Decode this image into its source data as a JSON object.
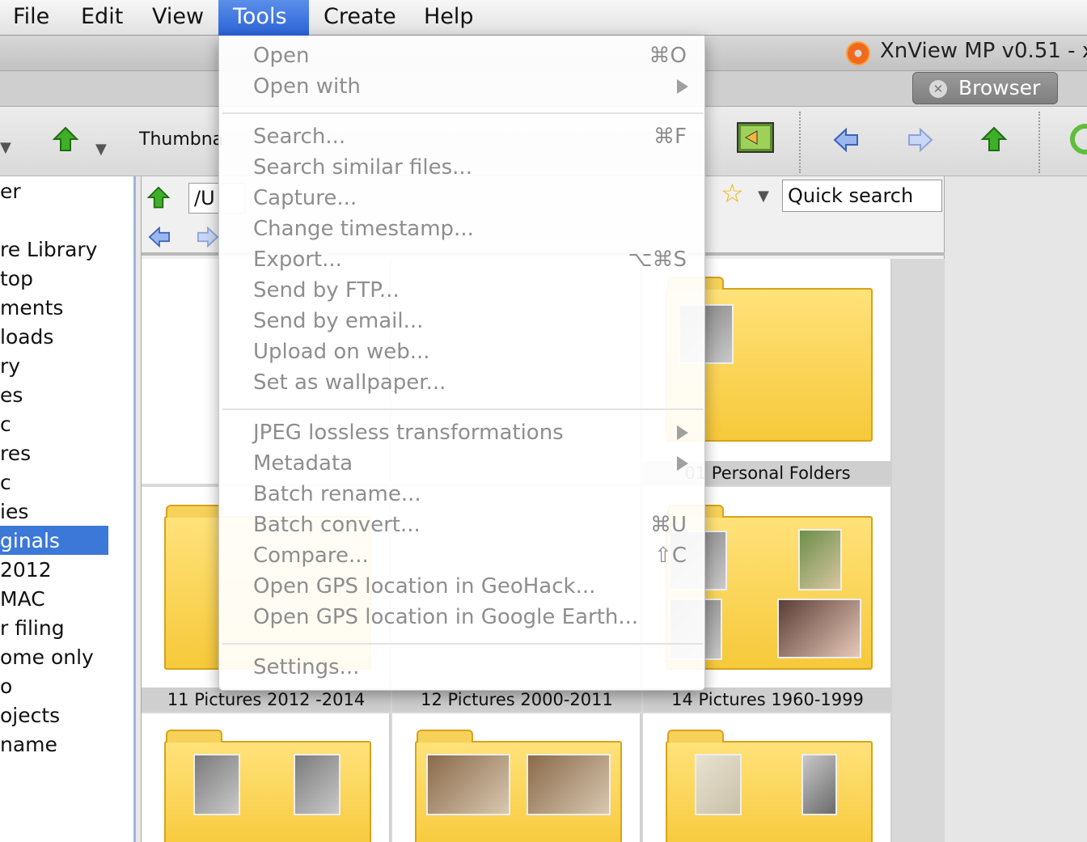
{
  "menubar": {
    "items": [
      "File",
      "Edit",
      "View",
      "Tools",
      "Create",
      "Help"
    ],
    "active": "Tools"
  },
  "window": {
    "title": "XnView MP v0.51 - x",
    "tab_label": "Browser"
  },
  "toolbar": {
    "thumbnail_label": "Thumbna"
  },
  "tree": {
    "items": [
      "er",
      "re Library",
      "top",
      "ments",
      "loads",
      "ry",
      "es",
      "c",
      "res",
      "c",
      "ies",
      "ginals",
      "2012",
      "MAC",
      "r filing",
      "ome only",
      "o",
      "ojects",
      "name"
    ],
    "selected_index": 11
  },
  "browser": {
    "path": "/U",
    "quick_search_placeholder": "Quick search",
    "captions": [
      "01 Personal Folders",
      "11 Pictures 2012 -2014",
      "12 Pictures 2000-2011",
      "14 Pictures 1960-1999"
    ]
  },
  "tools_menu": {
    "items": [
      {
        "label": "Open",
        "shortcut": "⌘O"
      },
      {
        "label": "Open with",
        "submenu": true
      },
      {
        "label": "Search...",
        "shortcut": "⌘F"
      },
      {
        "label": "Search similar files..."
      },
      {
        "label": "Capture..."
      },
      {
        "label": "Change timestamp..."
      },
      {
        "label": "Export...",
        "shortcut": "⌥⌘S"
      },
      {
        "label": "Send by FTP..."
      },
      {
        "label": "Send by email..."
      },
      {
        "label": "Upload on web..."
      },
      {
        "label": "Set as wallpaper..."
      },
      {
        "label": "JPEG lossless transformations",
        "submenu": true
      },
      {
        "label": "Metadata",
        "submenu": true
      },
      {
        "label": "Batch rename..."
      },
      {
        "label": "Batch convert...",
        "shortcut": "⌘U"
      },
      {
        "label": "Compare...",
        "shortcut": "⇧C"
      },
      {
        "label": "Open GPS location in GeoHack..."
      },
      {
        "label": "Open GPS location in Google Earth..."
      },
      {
        "label": "Settings..."
      }
    ]
  },
  "icons": [
    "app-logo-icon",
    "close-tab-icon",
    "up-folder-icon",
    "back-arrow-icon",
    "forward-arrow-icon",
    "favorite-star-icon",
    "dropdown-arrow-icon",
    "slideshow-icon",
    "refresh-icon",
    "submenu-arrow-icon"
  ],
  "colors": {
    "menu_highlight": "#2a63d8",
    "selection": "#3c78d8",
    "folder": "#f7c93a"
  }
}
